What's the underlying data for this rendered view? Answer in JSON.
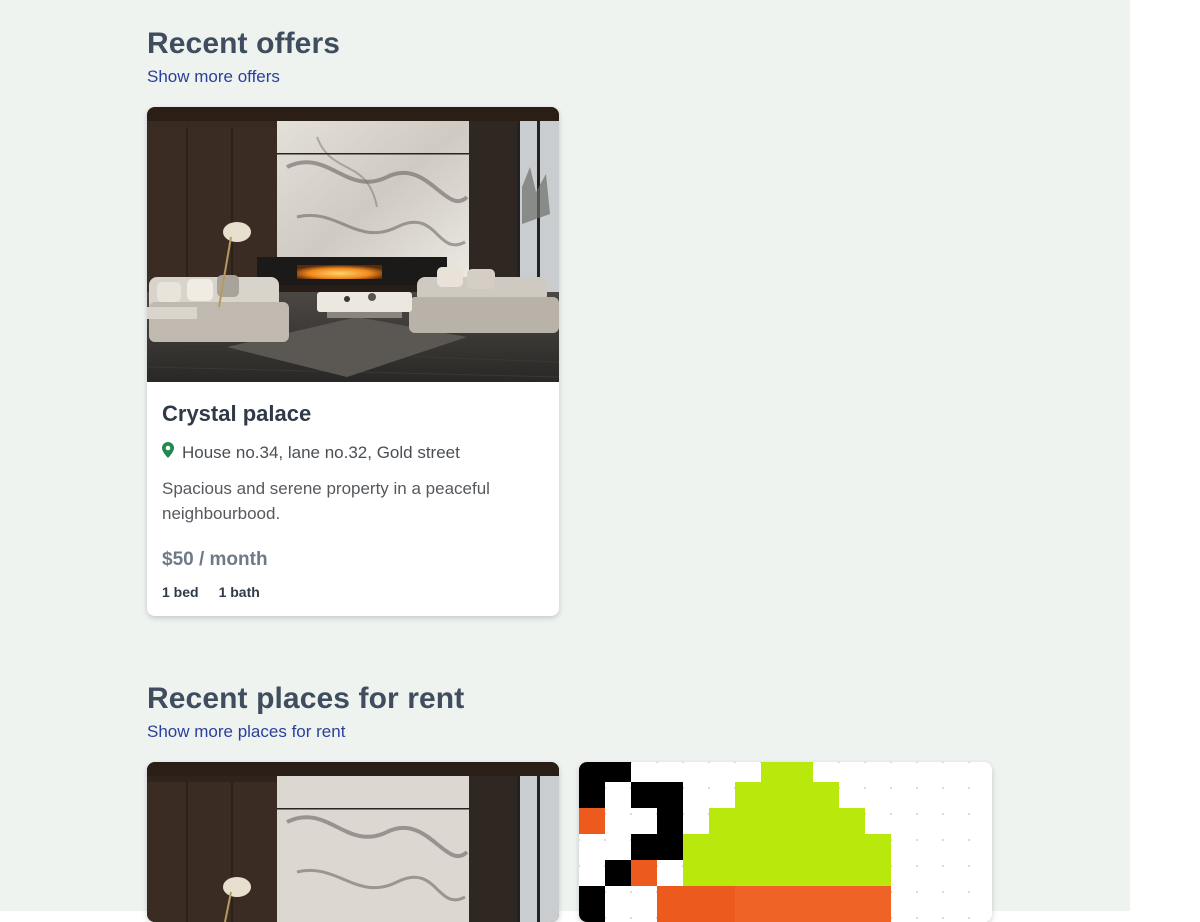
{
  "offers": {
    "title": "Recent offers",
    "link": "Show more offers",
    "cards": [
      {
        "title": "Crystal palace",
        "address": "House no.34, lane no.32, Gold street",
        "description": "Spacious and serene property in a peaceful neighbourbood.",
        "price": "$50 / month",
        "beds": "1 bed",
        "baths": "1 bath"
      }
    ]
  },
  "rent": {
    "title": "Recent places for rent",
    "link": "Show more places for rent"
  },
  "icons": {
    "location": "map-pin-icon"
  },
  "colors": {
    "background": "#eff3f0",
    "link": "#2a3f9a",
    "pin": "#1f8a4c",
    "pixel_green": "#b8e80c",
    "pixel_orange": "#ec5a1d"
  }
}
